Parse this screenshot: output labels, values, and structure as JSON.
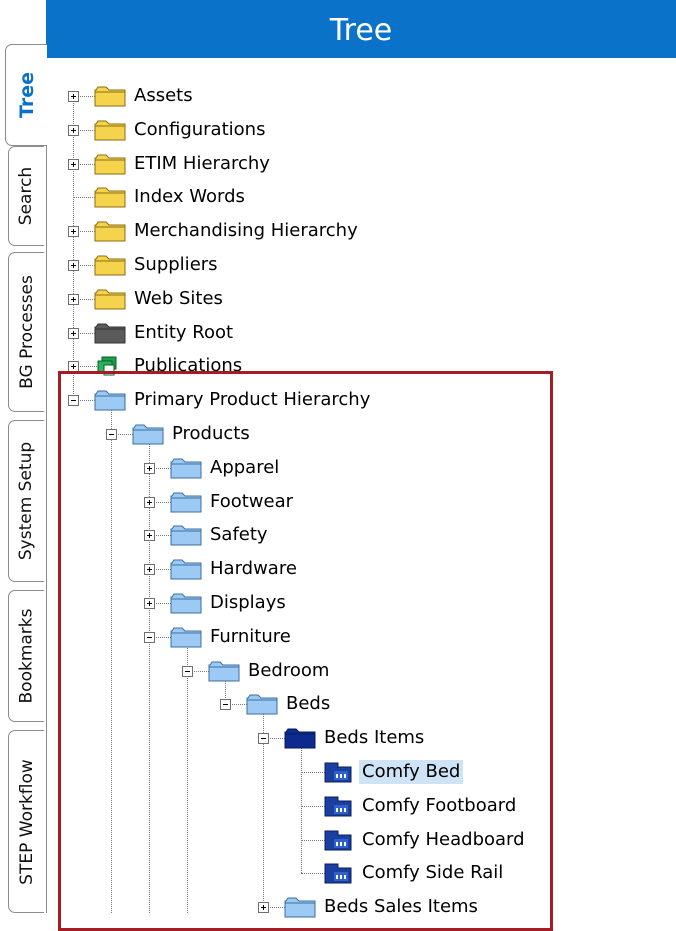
{
  "header": {
    "title": "Tree"
  },
  "tabs": [
    {
      "label": "Tree",
      "active": true
    },
    {
      "label": "Search",
      "active": false
    },
    {
      "label": "BG Processes",
      "active": false
    },
    {
      "label": "System Setup",
      "active": false
    },
    {
      "label": "Bookmarks",
      "active": false
    },
    {
      "label": "STEP Workflow",
      "active": false
    }
  ],
  "tree": [
    {
      "label": "Assets",
      "depth": 0,
      "toggle": "plus",
      "icon": "folder-yellow-icon"
    },
    {
      "label": "Configurations",
      "depth": 0,
      "toggle": "plus",
      "icon": "folder-yellow-icon"
    },
    {
      "label": "ETIM Hierarchy",
      "depth": 0,
      "toggle": "plus",
      "icon": "folder-yellow-icon"
    },
    {
      "label": "Index Words",
      "depth": 0,
      "toggle": "none",
      "icon": "folder-yellow-icon"
    },
    {
      "label": "Merchandising Hierarchy",
      "depth": 0,
      "toggle": "plus",
      "icon": "folder-yellow-icon"
    },
    {
      "label": "Suppliers",
      "depth": 0,
      "toggle": "plus",
      "icon": "folder-yellow-icon"
    },
    {
      "label": "Web Sites",
      "depth": 0,
      "toggle": "plus",
      "icon": "folder-yellow-icon"
    },
    {
      "label": "Entity Root",
      "depth": 0,
      "toggle": "plus",
      "icon": "folder-gray-icon"
    },
    {
      "label": "Publications",
      "depth": 0,
      "toggle": "plus",
      "icon": "publications-icon"
    },
    {
      "label": "Primary Product Hierarchy",
      "depth": 0,
      "toggle": "minus",
      "icon": "folder-blue-icon"
    },
    {
      "label": "Products",
      "depth": 1,
      "toggle": "minus",
      "icon": "folder-blue-icon"
    },
    {
      "label": "Apparel",
      "depth": 2,
      "toggle": "plus",
      "icon": "folder-blue-icon"
    },
    {
      "label": "Footwear",
      "depth": 2,
      "toggle": "plus",
      "icon": "folder-blue-icon"
    },
    {
      "label": "Safety",
      "depth": 2,
      "toggle": "plus",
      "icon": "folder-blue-icon"
    },
    {
      "label": "Hardware",
      "depth": 2,
      "toggle": "plus",
      "icon": "folder-blue-icon"
    },
    {
      "label": "Displays",
      "depth": 2,
      "toggle": "plus",
      "icon": "folder-blue-icon"
    },
    {
      "label": "Furniture",
      "depth": 2,
      "toggle": "minus",
      "icon": "folder-blue-icon"
    },
    {
      "label": "Bedroom",
      "depth": 3,
      "toggle": "minus",
      "icon": "folder-blue-icon"
    },
    {
      "label": "Beds",
      "depth": 4,
      "toggle": "minus",
      "icon": "folder-blue-icon"
    },
    {
      "label": "Beds Items",
      "depth": 5,
      "toggle": "minus",
      "icon": "folder-darkblue-icon"
    },
    {
      "label": "Comfy Bed",
      "depth": 6,
      "toggle": "none",
      "icon": "product-icon",
      "selected": true
    },
    {
      "label": "Comfy Footboard",
      "depth": 6,
      "toggle": "none",
      "icon": "product-icon"
    },
    {
      "label": "Comfy Headboard",
      "depth": 6,
      "toggle": "none",
      "icon": "product-icon"
    },
    {
      "label": "Comfy Side Rail",
      "depth": 6,
      "toggle": "none",
      "icon": "product-icon"
    },
    {
      "label": "Beds Sales Items",
      "depth": 5,
      "toggle": "plus",
      "icon": "folder-blue-icon"
    }
  ],
  "colors": {
    "header": "#0a72c9",
    "folder_yellow": "#f6d34c",
    "folder_blue": "#9ccaf5",
    "folder_darkblue": "#0d2a8f",
    "highlight_border": "#a51c24",
    "selection": "#cfe3f7"
  }
}
